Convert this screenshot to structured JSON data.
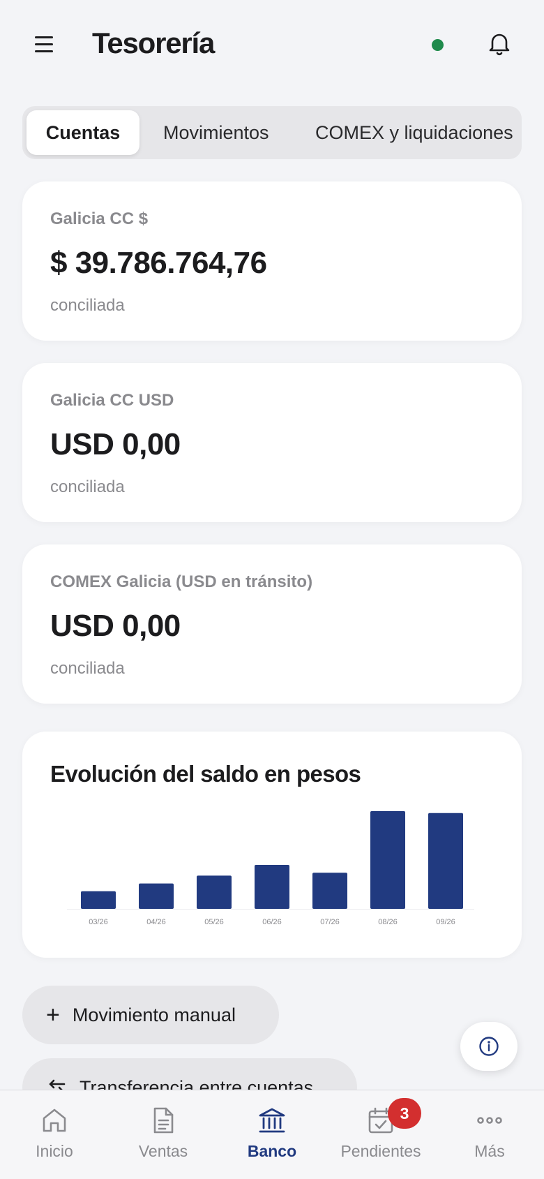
{
  "header": {
    "title": "Tesorería",
    "menu_icon": "hamburger-icon",
    "status_color": "#1f8a4c",
    "bell_icon": "bell-icon"
  },
  "tabs": [
    {
      "label": "Cuentas",
      "active": true
    },
    {
      "label": "Movimientos",
      "active": false
    },
    {
      "label": "COMEX y liquidaciones",
      "active": false
    }
  ],
  "accounts": [
    {
      "name": "Galicia CC $",
      "balance": "$ 39.786.764,76",
      "status": "conciliada"
    },
    {
      "name": "Galicia CC USD",
      "balance": "USD 0,00",
      "status": "conciliada"
    },
    {
      "name": "COMEX Galicia (USD en tránsito)",
      "balance": "USD 0,00",
      "status": "conciliada"
    }
  ],
  "chart_section": {
    "title": "Evolución del saldo en pesos"
  },
  "chart_data": {
    "type": "bar",
    "categories": [
      "03/26",
      "04/26",
      "05/26",
      "06/26",
      "07/26",
      "08/26",
      "09/26"
    ],
    "values": [
      18,
      26,
      34,
      45,
      37,
      100,
      98
    ],
    "bar_color": "#213a80",
    "grid": false,
    "title": "Evolución del saldo en pesos"
  },
  "actions": [
    {
      "label": "Movimiento manual",
      "icon": "plus-icon"
    },
    {
      "label": "Transferencia entre cuentas",
      "icon": "transfer-icon"
    }
  ],
  "fab": {
    "icon": "info-icon"
  },
  "bottom_nav": [
    {
      "label": "Inicio",
      "icon": "home-icon",
      "active": false
    },
    {
      "label": "Ventas",
      "icon": "document-icon",
      "active": false
    },
    {
      "label": "Banco",
      "icon": "bank-icon",
      "active": true
    },
    {
      "label": "Pendientes",
      "icon": "calendar-check-icon",
      "active": false,
      "badge": "3"
    },
    {
      "label": "Más",
      "icon": "more-icon",
      "active": false
    }
  ],
  "colors": {
    "accent": "#213a80",
    "badge": "#d32f2f",
    "background": "#f3f4f7"
  }
}
